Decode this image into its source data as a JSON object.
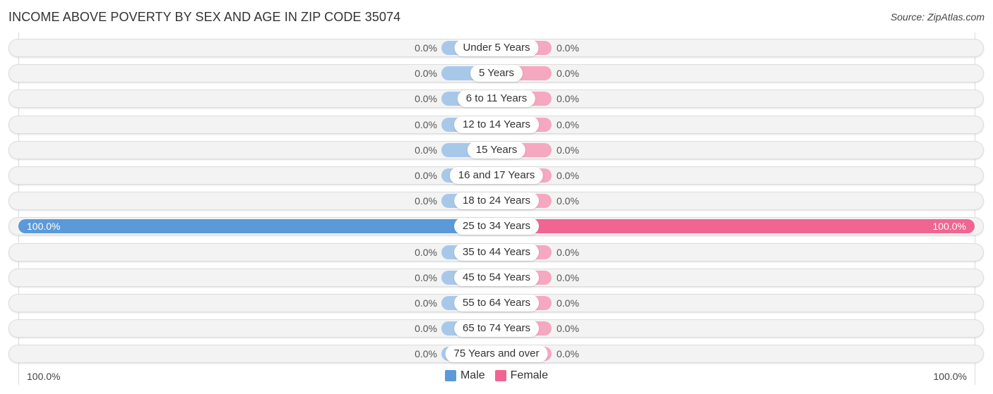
{
  "chart_data": {
    "type": "bar",
    "orientation": "horizontal-diverging",
    "title": "INCOME ABOVE POVERTY BY SEX AND AGE IN ZIP CODE 35074",
    "source": "Source: ZipAtlas.com",
    "categories": [
      "Under 5 Years",
      "5 Years",
      "6 to 11 Years",
      "12 to 14 Years",
      "15 Years",
      "16 and 17 Years",
      "18 to 24 Years",
      "25 to 34 Years",
      "35 to 44 Years",
      "45 to 54 Years",
      "55 to 64 Years",
      "65 to 74 Years",
      "75 Years and over"
    ],
    "series": [
      {
        "name": "Male",
        "color": "#5b9ad8",
        "light_color": "#a8c8ea",
        "values": [
          0.0,
          0.0,
          0.0,
          0.0,
          0.0,
          0.0,
          0.0,
          100.0,
          0.0,
          0.0,
          0.0,
          0.0,
          0.0
        ]
      },
      {
        "name": "Female",
        "color": "#f06592",
        "light_color": "#f5a8c0",
        "values": [
          0.0,
          0.0,
          0.0,
          0.0,
          0.0,
          0.0,
          0.0,
          100.0,
          0.0,
          0.0,
          0.0,
          0.0,
          0.0
        ]
      }
    ],
    "value_labels": {
      "male": [
        "0.0%",
        "0.0%",
        "0.0%",
        "0.0%",
        "0.0%",
        "0.0%",
        "0.0%",
        "100.0%",
        "0.0%",
        "0.0%",
        "0.0%",
        "0.0%",
        "0.0%"
      ],
      "female": [
        "0.0%",
        "0.0%",
        "0.0%",
        "0.0%",
        "0.0%",
        "0.0%",
        "0.0%",
        "100.0%",
        "0.0%",
        "0.0%",
        "0.0%",
        "0.0%",
        "0.0%"
      ]
    },
    "xlim": [
      -100,
      100
    ],
    "axis_labels": {
      "left": "100.0%",
      "right": "100.0%"
    },
    "legend": {
      "position": "bottom-center",
      "entries": [
        "Male",
        "Female"
      ]
    },
    "unit": "%"
  }
}
